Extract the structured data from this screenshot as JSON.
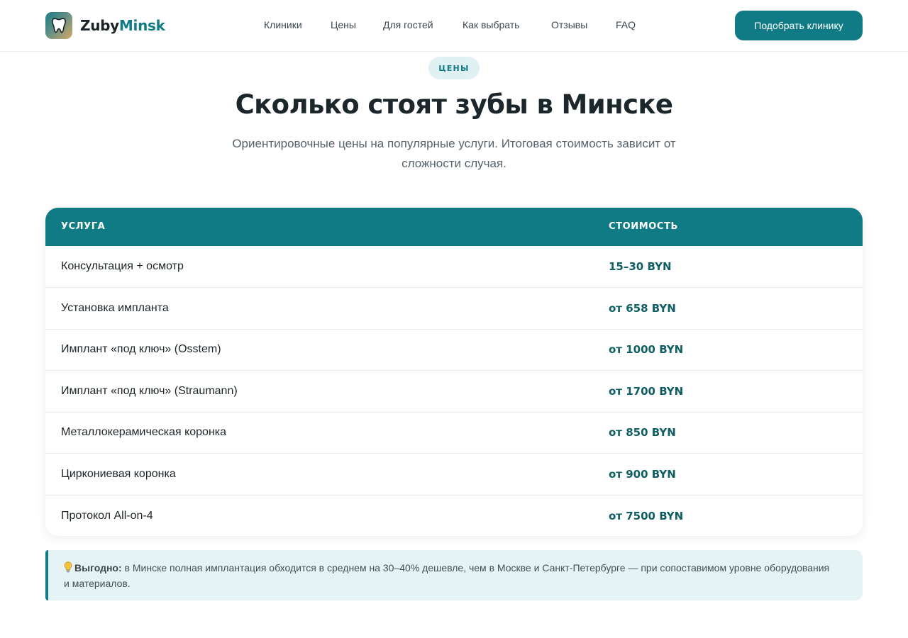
{
  "header": {
    "brand_part1": "Zuby",
    "brand_part2": "Minsk",
    "nav": [
      "Клиники",
      "Цены",
      "Для гостей",
      "Как выбрать",
      "Отзывы",
      "FAQ"
    ],
    "cta_label": "Подобрать клинику"
  },
  "hero": {
    "badge": "ЦЕНЫ",
    "title": "Сколько стоят зубы в Минске",
    "subtitle": "Ориентировочные цены на популярные услуги. Итоговая стоимость зависит от сложности случая."
  },
  "table": {
    "headers": [
      "УСЛУГА",
      "СТОИМОСТЬ"
    ],
    "rows": [
      {
        "service": "Консультация + осмотр",
        "price": "15–30 BYN"
      },
      {
        "service": "Установка импланта",
        "price": "от 658 BYN"
      },
      {
        "service": "Имплант «под ключ» (Osstem)",
        "price": "от 1000 BYN"
      },
      {
        "service": "Имплант «под ключ» (Straumann)",
        "price": "от 1700 BYN"
      },
      {
        "service": "Металлокерамическая коронка",
        "price": "от 850 BYN"
      },
      {
        "service": "Циркониевая коронка",
        "price": "от 900 BYN"
      },
      {
        "service": "Протокол All-on-4",
        "price": "от 7500 BYN"
      }
    ]
  },
  "tip": {
    "icon": "lightbulb-icon",
    "label": "Выгодно:",
    "text": " в Минске полная имплантация обходится в среднем на 30–40% дешевле, чем в Москве и Санкт-Петербурге — при сопоставимом уровне оборудования и материалов."
  },
  "colors": {
    "accent": "#107b84",
    "price": "#0f5e63",
    "badge_bg": "#dff1f3",
    "tip_bg": "#e6f3f4"
  }
}
